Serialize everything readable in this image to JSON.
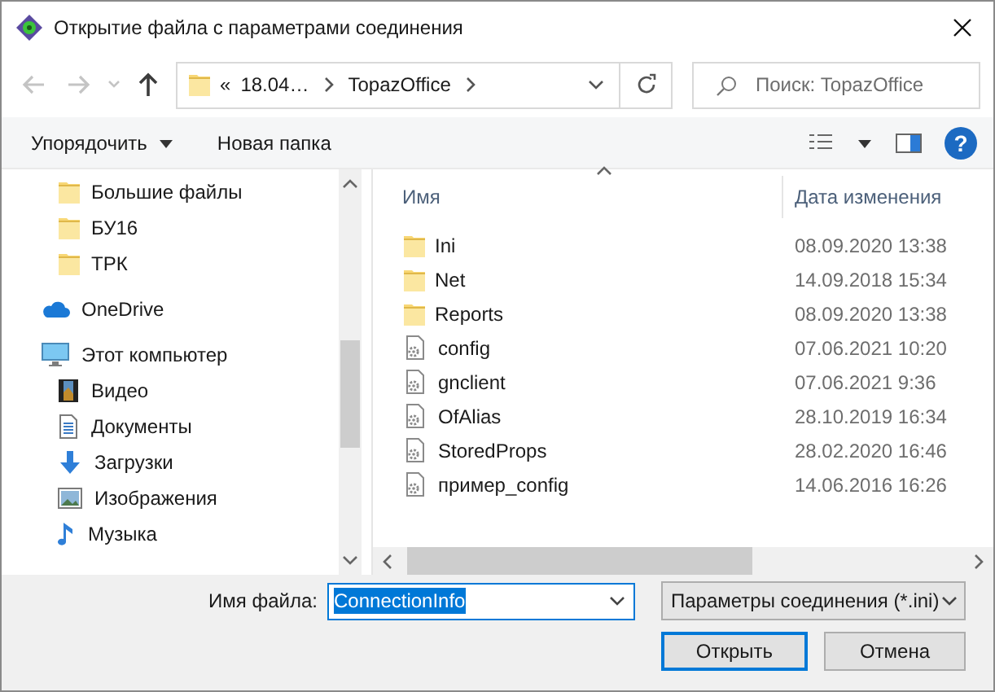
{
  "window": {
    "title": "Открытие файла с параметрами соединения"
  },
  "nav_buttons": [
    {
      "kind": "back",
      "disabled": true
    },
    {
      "kind": "forward",
      "disabled": true
    },
    {
      "kind": "recent",
      "disabled": true
    },
    {
      "kind": "up",
      "disabled": false
    }
  ],
  "address_bar": {
    "crumbs": [
      "«",
      "18.04…",
      "TopazOffice"
    ]
  },
  "search": {
    "placeholder": "Поиск: TopazOffice"
  },
  "toolbar": {
    "organize": "Упорядочить",
    "new_folder": "Новая папка",
    "help": "?"
  },
  "nav_pane": {
    "items": [
      {
        "label": "Большие файлы",
        "kind": "folder"
      },
      {
        "label": "БУ16",
        "kind": "folder"
      },
      {
        "label": "ТРК",
        "kind": "folder"
      },
      {
        "label": "OneDrive",
        "kind": "cloud"
      },
      {
        "label": "Этот компьютер",
        "kind": "computer",
        "children": [
          {
            "label": "Видео",
            "kind": "video"
          },
          {
            "label": "Документы",
            "kind": "documents"
          },
          {
            "label": "Загрузки",
            "kind": "downloads"
          },
          {
            "label": "Изображения",
            "kind": "pictures"
          },
          {
            "label": "Музыка",
            "kind": "music"
          }
        ]
      }
    ]
  },
  "file_list": {
    "columns": [
      "Имя",
      "Дата изменения"
    ],
    "rows": [
      {
        "name": "Ini",
        "kind": "folder",
        "date": "08.09.2020 13:38"
      },
      {
        "name": "Net",
        "kind": "folder",
        "date": "14.09.2018 15:34"
      },
      {
        "name": "Reports",
        "kind": "folder",
        "date": "08.09.2020 13:38"
      },
      {
        "name": "config",
        "kind": "file",
        "date": "07.06.2021 10:20"
      },
      {
        "name": "gnclient",
        "kind": "file",
        "date": "07.06.2021 9:36"
      },
      {
        "name": "OfAlias",
        "kind": "file",
        "date": "28.10.2019 16:34"
      },
      {
        "name": "StoredProps",
        "kind": "file",
        "date": "28.02.2020 16:46"
      },
      {
        "name": "пример_config",
        "kind": "file",
        "date": "14.06.2016 16:26"
      }
    ]
  },
  "file_name": {
    "label": "Имя файла:",
    "value": "ConnectionInfo",
    "value_selected": true
  },
  "file_type": {
    "value": "Параметры соединения (*.ini)"
  },
  "buttons": [
    {
      "label": "Открыть",
      "default": true
    },
    {
      "label": "Отмена",
      "default": false
    }
  ]
}
